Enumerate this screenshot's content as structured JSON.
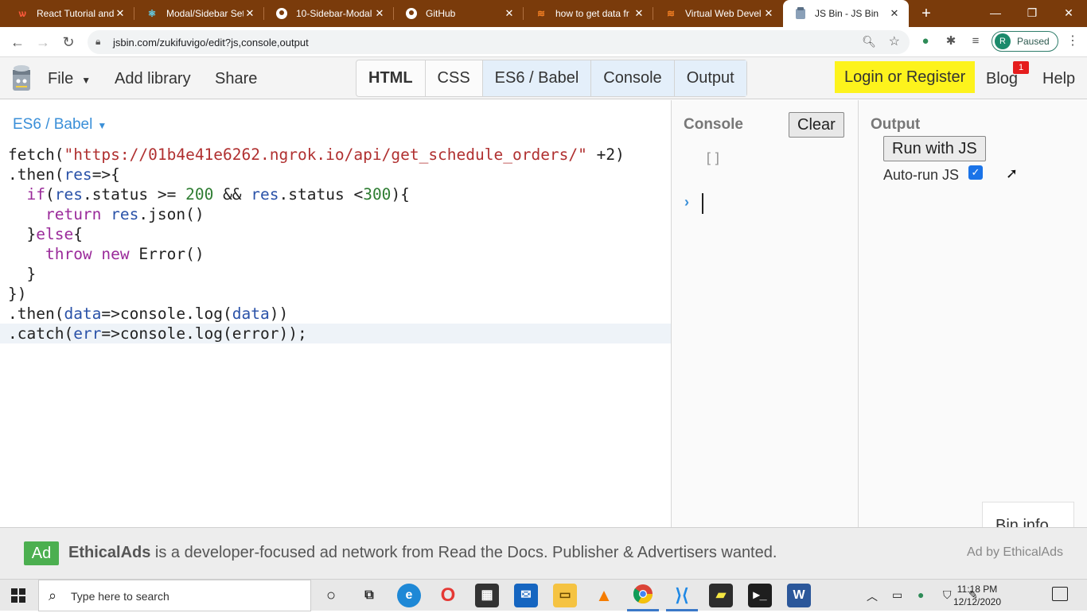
{
  "browser": {
    "tabs": [
      {
        "title": "React Tutorial and",
        "icon": "react-tutorial-favicon"
      },
      {
        "title": "Modal/Sidebar Set",
        "icon": "react-favicon"
      },
      {
        "title": "10-Sidebar-Modal",
        "icon": "github-favicon"
      },
      {
        "title": "GitHub",
        "icon": "github-favicon"
      },
      {
        "title": "how to get data fr",
        "icon": "stackoverflow-favicon"
      },
      {
        "title": "Virtual Web Devel",
        "icon": "stackoverflow-favicon"
      },
      {
        "title": "JS Bin - JS Bin",
        "icon": "jsbin-favicon",
        "active": true
      }
    ],
    "url": "jsbin.com/zukifuvigo/edit?js,console,output",
    "profile_initial": "R",
    "profile_status": "Paused"
  },
  "jsbin": {
    "menu": {
      "file": "File",
      "add_library": "Add library",
      "share": "Share"
    },
    "panes": [
      "HTML",
      "CSS",
      "ES6 / Babel",
      "Console",
      "Output"
    ],
    "login": "Login or Register",
    "blog": "Blog",
    "blog_badge": "1",
    "help": "Help"
  },
  "editor": {
    "language": "ES6 / Babel",
    "lines": [
      "fetch(\"https://01b4e41e6262.ngrok.io/api/get_schedule_orders/\" +2)",
      ".then(res=>{",
      "  if(res.status >= 200 && res.status <300){",
      "    return res.json()",
      "  }else{",
      "    throw new Error()",
      "  }",
      "})",
      ".then(data=>console.log(data))",
      ".catch(err=>console.log(error));"
    ]
  },
  "console": {
    "title": "Console",
    "clear_label": "Clear",
    "output": "[]",
    "prompt": "›"
  },
  "output": {
    "title": "Output",
    "run_label": "Run with JS",
    "autorun_label": "Auto-run JS",
    "autorun_checked": true,
    "bin_info": "Bin info"
  },
  "ad": {
    "tag": "Ad",
    "brand": "EthicalAds",
    "text": " is a developer-focused ad network from Read the Docs. Publisher & Advertisers wanted.",
    "by": "Ad by EthicalAds"
  },
  "taskbar": {
    "search_placeholder": "Type here to search",
    "time": "11:18 PM",
    "date": "12/12/2020"
  }
}
